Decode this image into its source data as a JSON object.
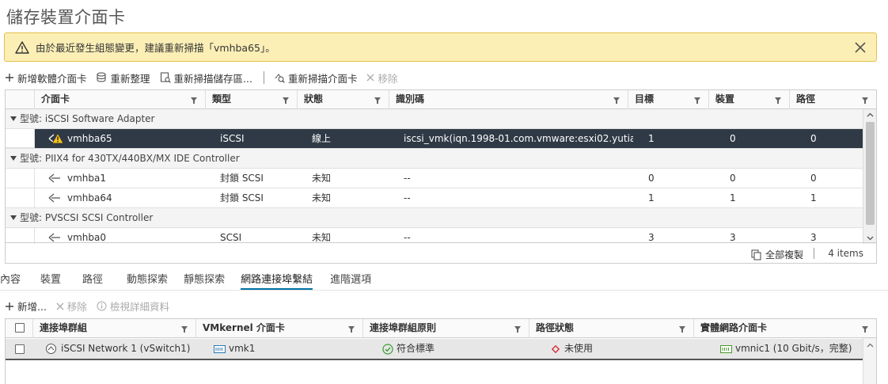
{
  "page": {
    "title": "儲存裝置介面卡"
  },
  "alert": {
    "message": "由於最近發生組態變更，建議重新掃描「vmhba65」。"
  },
  "toolbar": {
    "add_software": "新增軟體介面卡",
    "refresh": "重新整理",
    "rescan_storage": "重新掃描儲存區...",
    "rescan_adapter": "重新掃描介面卡",
    "remove": "移除"
  },
  "adapters_table": {
    "columns": [
      "介面卡",
      "類型",
      "狀態",
      "識別碼",
      "目標",
      "裝置",
      "路徑"
    ],
    "groups": [
      {
        "label": "型號: iSCSI Software Adapter",
        "rows": [
          {
            "adapter": "vmhba65",
            "type": "iSCSI",
            "status": "線上",
            "identifier": "iscsi_vmk(iqn.1998-01.com.vmware:esxi02.yutian...",
            "targets": "1",
            "devices": "0",
            "paths": "0"
          }
        ]
      },
      {
        "label": "型號: PIIX4 for 430TX/440BX/MX IDE Controller",
        "rows": [
          {
            "adapter": "vmhba1",
            "type": "封鎖 SCSI",
            "status": "未知",
            "identifier": "--",
            "targets": "0",
            "devices": "0",
            "paths": "0"
          },
          {
            "adapter": "vmhba64",
            "type": "封鎖 SCSI",
            "status": "未知",
            "identifier": "--",
            "targets": "1",
            "devices": "1",
            "paths": "1"
          }
        ]
      },
      {
        "label": "型號: PVSCSI SCSI Controller",
        "rows": [
          {
            "adapter": "vmhba0",
            "type": "SCSI",
            "status": "未知",
            "identifier": "--",
            "targets": "3",
            "devices": "3",
            "paths": "3"
          }
        ]
      }
    ],
    "footer": {
      "copy_all": "全部複製",
      "count": "4 items"
    }
  },
  "tabs": [
    "內容",
    "裝置",
    "路徑",
    "動態探索",
    "靜態探索",
    "網路連接埠繫結",
    "進階選項"
  ],
  "binding_toolbar": {
    "add": "新增...",
    "remove": "移除",
    "details": "檢視詳細資料"
  },
  "binding_table": {
    "columns": [
      "連接埠群組",
      "VMkernel 介面卡",
      "連接埠群組原則",
      "路徑狀態",
      "實體網路介面卡"
    ],
    "rows": [
      {
        "port_group": "iSCSI Network 1 (vSwitch1)",
        "vmkernel": "vmk1",
        "policy": "符合標準",
        "path_status": "未使用",
        "physical_nic": "vmnic1 (10 Gbit/s，完整)"
      }
    ]
  },
  "colors": {
    "accent": "#0072a3",
    "selected_row": "#2f3a46",
    "warning_bg": "#fbefb6"
  }
}
